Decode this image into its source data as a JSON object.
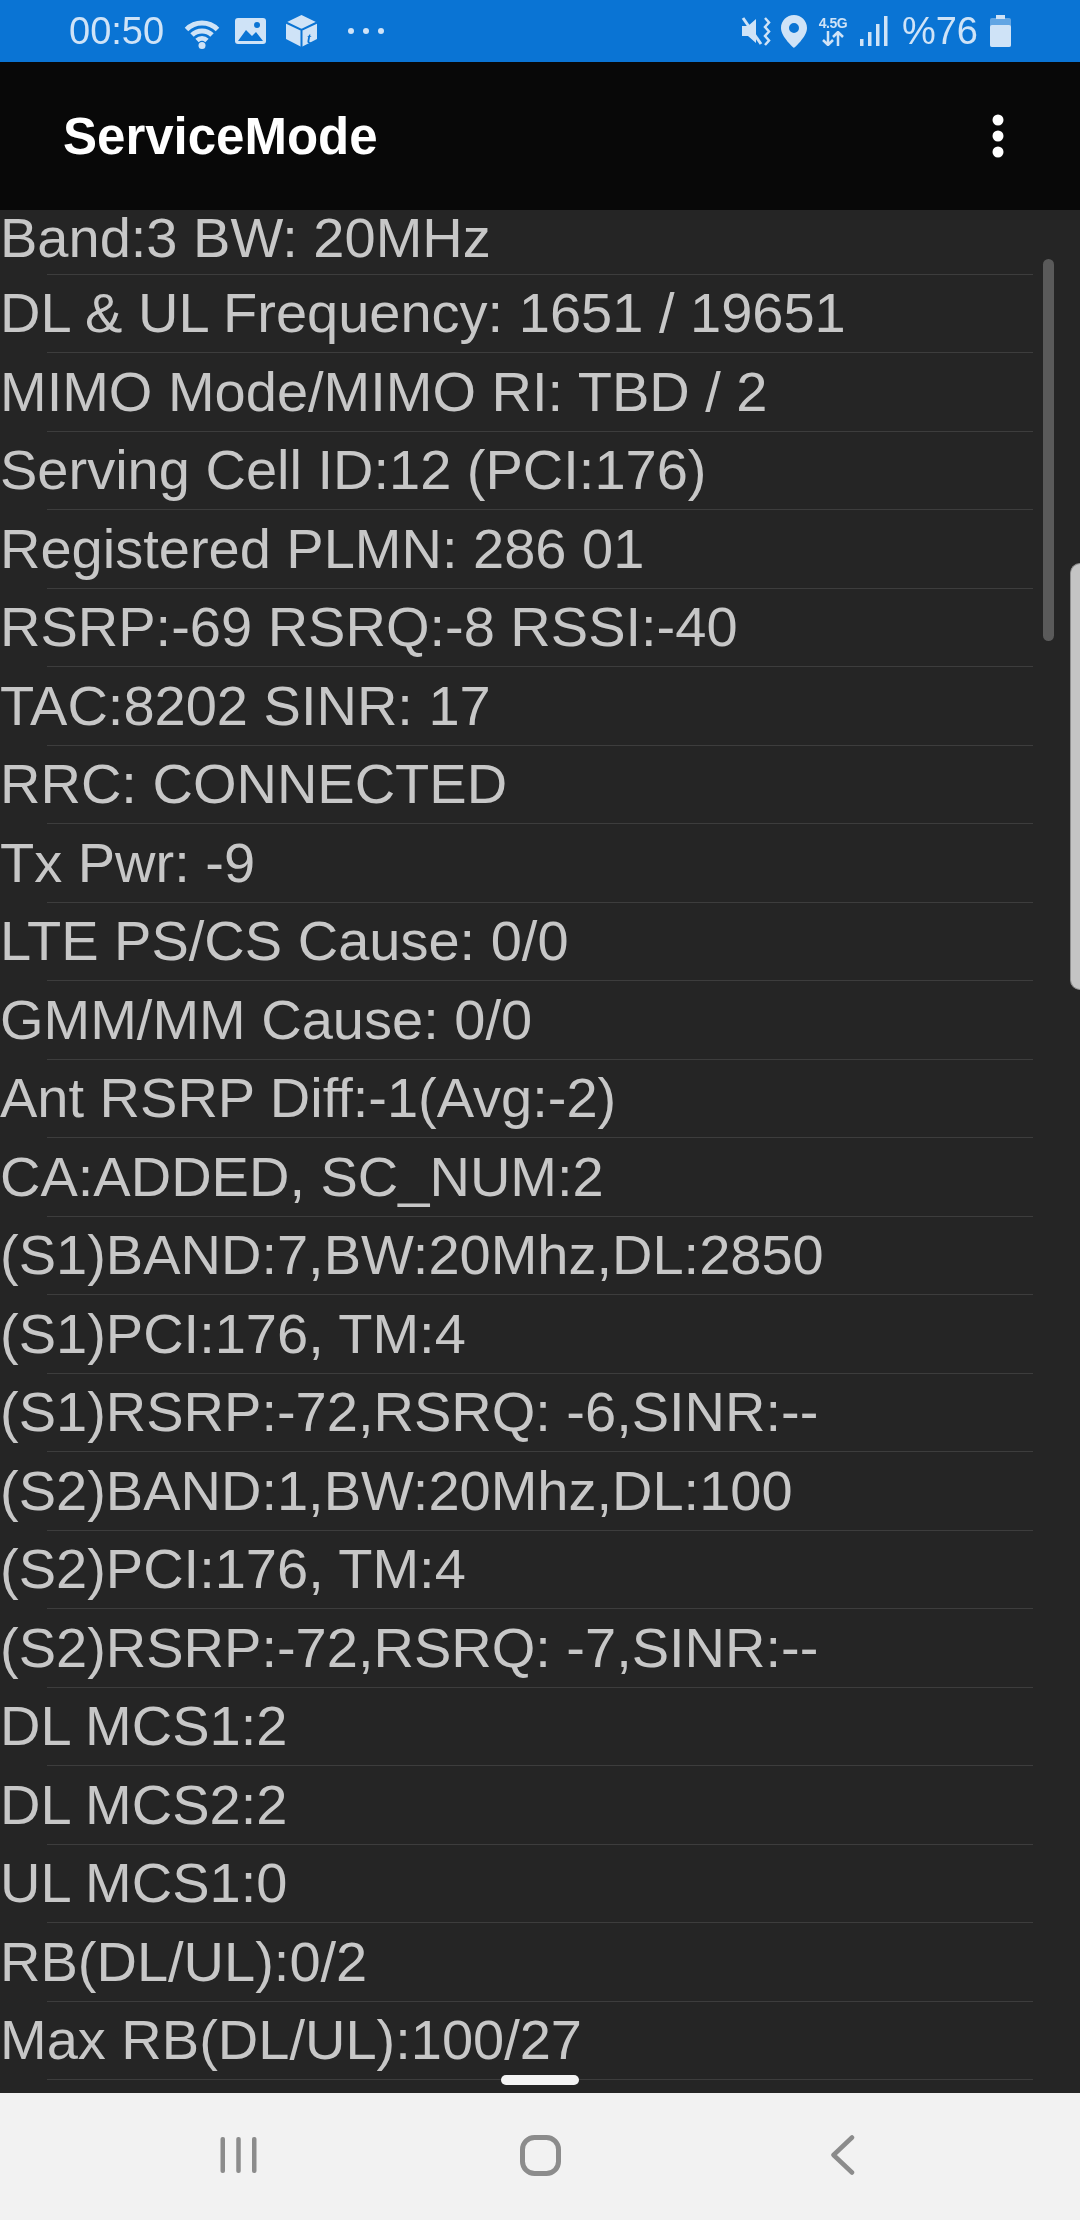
{
  "status_bar": {
    "time": "00:50",
    "app_icon_letter": "t",
    "network_type": "4.5G",
    "battery": "%76"
  },
  "app_bar": {
    "title": "ServiceMode"
  },
  "info_lines": [
    "Band:3 BW: 20MHz",
    "DL & UL Frequency: 1651 / 19651",
    "MIMO Mode/MIMO RI: TBD / 2",
    "Serving Cell ID:12 (PCI:176)",
    "Registered PLMN: 286 01",
    "RSRP:-69 RSRQ:-8 RSSI:-40",
    "TAC:8202 SINR: 17",
    "RRC: CONNECTED",
    "Tx Pwr: -9",
    "LTE PS/CS Cause: 0/0",
    "GMM/MM Cause: 0/0",
    "Ant RSRP Diff:-1(Avg:-2)",
    "CA:ADDED, SC_NUM:2",
    "(S1)BAND:7,BW:20Mhz,DL:2850",
    "(S1)PCI:176, TM:4",
    "(S1)RSRP:-72,RSRQ: -6,SINR:--",
    "(S2)BAND:1,BW:20Mhz,DL:100",
    "(S2)PCI:176, TM:4",
    "(S2)RSRP:-72,RSRQ: -7,SINR:--",
    "DL MCS1:2",
    "DL MCS2:2",
    "UL MCS1:0",
    "RB(DL/UL):0/2",
    "Max RB(DL/UL):100/27"
  ]
}
